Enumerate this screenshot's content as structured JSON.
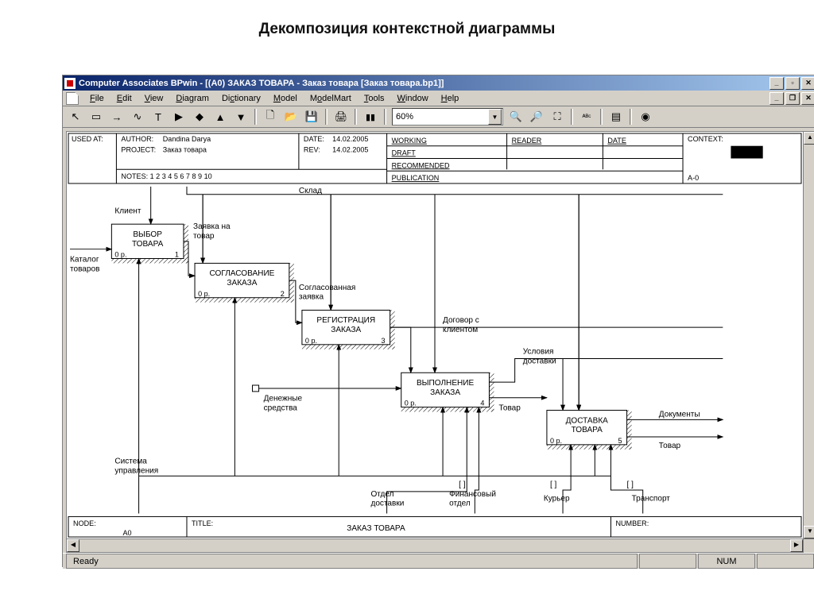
{
  "page_title": "Декомпозиция контекстной диаграммы",
  "window_title": "Computer Associates BPwin - [(A0) ЗАКАЗ ТОВАРА  - Заказ товара  [Заказ товара.bp1]]",
  "menu": {
    "file": "File",
    "edit": "Edit",
    "view": "View",
    "diagram": "Diagram",
    "dictionary": "Dictionary",
    "model": "Model",
    "modelmart": "ModelMart",
    "tools": "Tools",
    "window": "Window",
    "help": "Help"
  },
  "zoom_value": "60%",
  "status_ready": "Ready",
  "status_num": "NUM",
  "header": {
    "used_at": "USED AT:",
    "author_lbl": "AUTHOR:",
    "author_val": "Dandina Darya",
    "project_lbl": "PROJECT:",
    "project_val": "Заказ товара",
    "date_lbl": "DATE:",
    "date_val": "14.02.2005",
    "rev_lbl": "REV:",
    "rev_val": "14.02.2005",
    "working": "WORKING",
    "draft": "DRAFT",
    "recommended": "RECOMMENDED",
    "publication": "PUBLICATION",
    "reader": "READER",
    "date2": "DATE",
    "context": "CONTEXT:",
    "context_code": "A-0",
    "notes": "NOTES:  1  2  3  4  5  6  7  8  9  10",
    "node_lbl": "NODE:",
    "node_val": "A0",
    "title_lbl": "TITLE:",
    "title_val": "ЗАКАЗ ТОВАРА",
    "number_lbl": "NUMBER:"
  },
  "boxes": {
    "b1": {
      "line1": "ВЫБОР",
      "line2": "ТОВАРА",
      "cost": "0 р.",
      "num": "1"
    },
    "b2": {
      "line1": "СОГЛАСОВАНИЕ",
      "line2": "ЗАКАЗА",
      "cost": "0 р.",
      "num": "2"
    },
    "b3": {
      "line1": "РЕГИСТРАЦИЯ",
      "line2": "ЗАКАЗА",
      "cost": "0 р.",
      "num": "3"
    },
    "b4": {
      "line1": "ВЫПОЛНЕНИЕ",
      "line2": "ЗАКАЗА",
      "cost": "0 р.",
      "num": "4"
    },
    "b5": {
      "line1": "ДОСТАВКА",
      "line2": "ТОВАРА",
      "cost": "0 р.",
      "num": "5"
    }
  },
  "labels": {
    "klient": "Клиент",
    "sklad": "Склад",
    "katalog": "Каталог\nтоваров",
    "zayavka": "Заявка на\nтовар",
    "soglas_zayavka": "Согласованная\nзаявка",
    "dogovor": "Договор с\nклиентом",
    "usloviya": "Условия\nдоставки",
    "denezh": "Денежные\nсредства",
    "tovar": "Товар",
    "documents": "Документы",
    "tovar2": "Товар",
    "sistema": "Система\nуправления",
    "otdel": "Отдел\nдоставки",
    "finotdel": "Финансовый\nотдел",
    "kurer": "Курьер",
    "transport": "Транспорт"
  }
}
